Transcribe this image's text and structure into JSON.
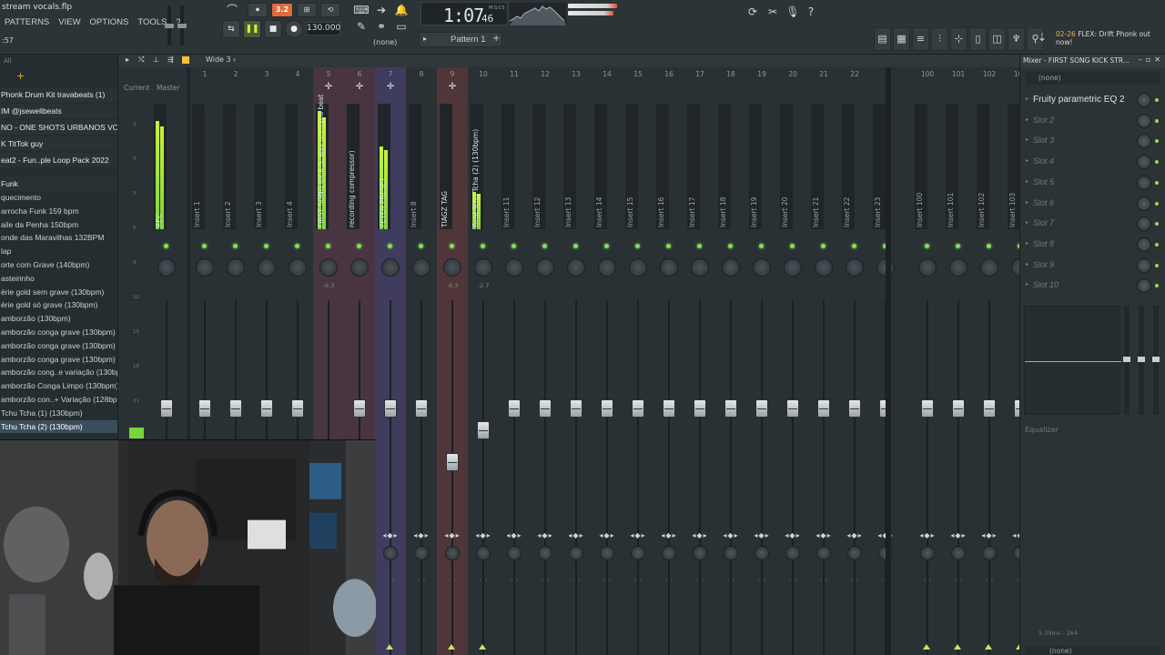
{
  "window": {
    "file_title": "stream vocals.flp",
    "hint_readout": ":57"
  },
  "menu": [
    "PATTERNS",
    "VIEW",
    "OPTIONS",
    "TOOLS",
    "?"
  ],
  "transport": {
    "tempo": "130.000",
    "time": "1:07",
    "time_ms": "46",
    "time_unit": "M:S:CS",
    "pattern": "Pattern 1",
    "snap": "(none)",
    "rec_badge": "3.2"
  },
  "hint": {
    "date": "02-26",
    "text": "FLEX: Drift Phonk out now!"
  },
  "browser": {
    "header": "All",
    "items": [
      {
        "label": "Phonk Drum Kit travabeats (1)",
        "kind": "folder"
      },
      {
        "label": "IM @jsewellbeats",
        "kind": "folder"
      },
      {
        "label": "NO - ONE SHOTS URBANOS VOL. 2",
        "kind": "folder"
      },
      {
        "label": "K TitTok guy",
        "kind": "folder"
      },
      {
        "label": "eat2 - Fun..ple Loop Pack 2022",
        "kind": "folder"
      },
      {
        "label": "Funk",
        "kind": "cat"
      },
      {
        "label": "quecimento",
        "kind": "item"
      },
      {
        "label": "arrocha Funk 159 bpm",
        "kind": "item"
      },
      {
        "label": "aile da Penha 150bpm",
        "kind": "item"
      },
      {
        "label": "onde das Maravilhas 132BPM",
        "kind": "item"
      },
      {
        "label": "lap",
        "kind": "item"
      },
      {
        "label": "orte com Grave (140bpm)",
        "kind": "item"
      },
      {
        "label": "asteirinho",
        "kind": "item"
      },
      {
        "label": "érie gold sem grave (130bpm)",
        "kind": "item"
      },
      {
        "label": "érie gold só grave (130bpm)",
        "kind": "item"
      },
      {
        "label": "amborzão (130bpm)",
        "kind": "item"
      },
      {
        "label": "amborzão conga grave (130bpm) (1)",
        "kind": "item"
      },
      {
        "label": "amborzão conga grave (130bpm) (2)",
        "kind": "item"
      },
      {
        "label": "amborzão conga grave (130bpm) (3)",
        "kind": "item"
      },
      {
        "label": "amborzão cong..e variação (130bpm)",
        "kind": "item"
      },
      {
        "label": "amborzão Conga Limpo (130bpm)",
        "kind": "item"
      },
      {
        "label": "amborzão con..+ Variação (128bpm)",
        "kind": "item"
      },
      {
        "label": "Tchu Tcha (1) (130bpm)",
        "kind": "item"
      },
      {
        "label": "Tchu Tcha (2) (130bpm)",
        "kind": "sel"
      }
    ]
  },
  "mixer": {
    "layout": "Wide 3",
    "current_label": "Current",
    "master_label": "Master",
    "strips": [
      {
        "num": "",
        "name": "REC",
        "named": true,
        "level": 0.86,
        "fader": 0.28,
        "hl": "",
        "peak": ""
      },
      {
        "num": "1",
        "name": "Insert 1",
        "named": false,
        "level": 0,
        "fader": 0.28,
        "hl": "",
        "peak": ""
      },
      {
        "num": "2",
        "name": "Insert 2",
        "named": false,
        "level": 0,
        "fader": 0.28,
        "hl": "",
        "peak": ""
      },
      {
        "num": "3",
        "name": "Insert 3",
        "named": false,
        "level": 0,
        "fader": 0.28,
        "hl": "",
        "peak": ""
      },
      {
        "num": "4",
        "name": "Insert 4",
        "named": false,
        "level": 0,
        "fader": 0.28,
        "hl": "",
        "peak": ""
      },
      {
        "num": "5",
        "name": "FIRST SONG KICK S..wav unmixed beat",
        "named": true,
        "level": 0.94,
        "fader": 0.4,
        "hl": "pink",
        "peak": "-6.3",
        "green": true
      },
      {
        "num": "6",
        "name": "recording compressor)",
        "named": true,
        "level": 0,
        "fader": 0.28,
        "hl": "pink",
        "peak": ""
      },
      {
        "num": "7",
        "name": "PETER PRESET",
        "named": true,
        "level": 0.66,
        "fader": 0.28,
        "hl": "purple",
        "peak": ""
      },
      {
        "num": "8",
        "name": "Insert 8",
        "named": false,
        "level": 0,
        "fader": 0.28,
        "hl": "",
        "peak": ""
      },
      {
        "num": "9",
        "name": "TIAGZ TAG",
        "named": true,
        "level": 0,
        "fader": 0.43,
        "hl": "red",
        "peak": "-6.3"
      },
      {
        "num": "10",
        "name": "Beat Tchu Tcha (2) (130bpm)",
        "named": true,
        "level": 0.3,
        "fader": 0.34,
        "hl": "",
        "peak": "-2.7"
      },
      {
        "num": "11",
        "name": "Insert 11",
        "named": false,
        "level": 0,
        "fader": 0.28,
        "hl": "",
        "peak": ""
      },
      {
        "num": "12",
        "name": "Insert 12",
        "named": false,
        "level": 0,
        "fader": 0.28,
        "hl": "",
        "peak": ""
      },
      {
        "num": "13",
        "name": "Insert 13",
        "named": false,
        "level": 0,
        "fader": 0.28,
        "hl": "",
        "peak": ""
      },
      {
        "num": "14",
        "name": "Insert 14",
        "named": false,
        "level": 0,
        "fader": 0.28,
        "hl": "",
        "peak": ""
      },
      {
        "num": "15",
        "name": "Insert 15",
        "named": false,
        "level": 0,
        "fader": 0.28,
        "hl": "",
        "peak": ""
      },
      {
        "num": "16",
        "name": "Insert 16",
        "named": false,
        "level": 0,
        "fader": 0.28,
        "hl": "",
        "peak": ""
      },
      {
        "num": "17",
        "name": "Insert 17",
        "named": false,
        "level": 0,
        "fader": 0.28,
        "hl": "",
        "peak": ""
      },
      {
        "num": "18",
        "name": "Insert 18",
        "named": false,
        "level": 0,
        "fader": 0.28,
        "hl": "",
        "peak": ""
      },
      {
        "num": "19",
        "name": "Insert 19",
        "named": false,
        "level": 0,
        "fader": 0.28,
        "hl": "",
        "peak": ""
      },
      {
        "num": "20",
        "name": "Insert 20",
        "named": false,
        "level": 0,
        "fader": 0.28,
        "hl": "",
        "peak": ""
      },
      {
        "num": "21",
        "name": "Insert 21",
        "named": false,
        "level": 0,
        "fader": 0.28,
        "hl": "",
        "peak": ""
      },
      {
        "num": "22",
        "name": "Insert 22",
        "named": false,
        "level": 0,
        "fader": 0.28,
        "hl": "",
        "peak": ""
      },
      {
        "num": "",
        "name": "Insert 23",
        "named": false,
        "level": 0,
        "fader": 0.28,
        "hl": "",
        "peak": ""
      },
      {
        "num": "100",
        "name": "Insert 100",
        "named": false,
        "level": 0,
        "fader": 0.28,
        "hl": "",
        "peak": ""
      },
      {
        "num": "101",
        "name": "Insert 101",
        "named": false,
        "level": 0,
        "fader": 0.28,
        "hl": "",
        "peak": ""
      },
      {
        "num": "102",
        "name": "Insert 102",
        "named": false,
        "level": 0,
        "fader": 0.28,
        "hl": "",
        "peak": ""
      },
      {
        "num": "103",
        "name": "Insert 103",
        "named": false,
        "level": 0,
        "fader": 0.28,
        "hl": "",
        "peak": ""
      }
    ]
  },
  "insert_panel": {
    "title": "Mixer - FIRST SONG KICK STR...",
    "none": "(none)",
    "slots": [
      "Fruity parametric EQ 2",
      "Slot 2",
      "Slot 3",
      "Slot 4",
      "Slot 5",
      "Slot 6",
      "Slot 7",
      "Slot 8",
      "Slot 9",
      "Slot 10"
    ],
    "eq_label": "Equalizer",
    "footer": "5.39ms - 264",
    "none_bottom": "(none)"
  },
  "colors": {
    "accent_green": "#9de03a",
    "orange": "#e06a3a"
  }
}
